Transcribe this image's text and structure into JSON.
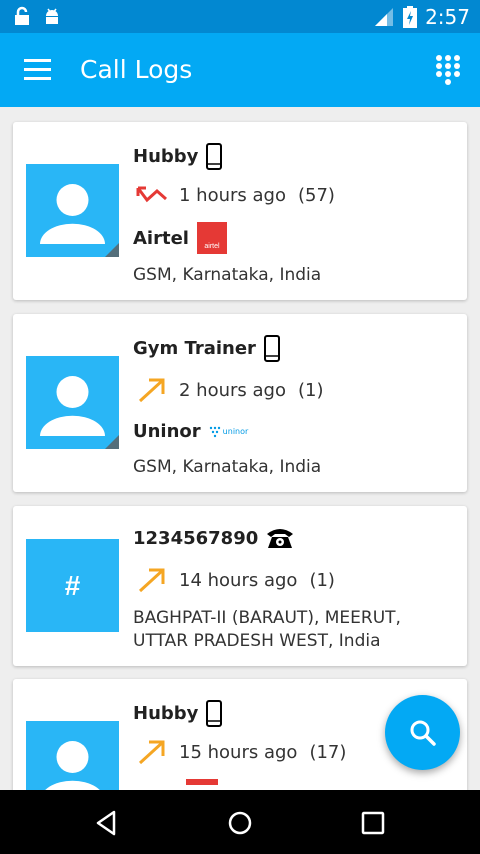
{
  "status_bar": {
    "time": "2:57"
  },
  "app_bar": {
    "title": "Call Logs"
  },
  "calls": [
    {
      "name": "Hubby",
      "time_ago": "1 hours ago",
      "count": "(57)",
      "direction": "missed",
      "operator": "Airtel",
      "operator_logo_text": "airtel",
      "location": "GSM, Karnataka, India",
      "device": "mobile"
    },
    {
      "name": "Gym Trainer",
      "time_ago": "2 hours ago",
      "count": "(1)",
      "direction": "outgoing",
      "operator": "Uninor",
      "operator_logo_text": "uninor",
      "location": "GSM, Karnataka, India",
      "device": "mobile"
    },
    {
      "name": "1234567890",
      "time_ago": "14 hours ago",
      "count": "(1)",
      "direction": "outgoing",
      "avatar_text": "#",
      "location": "BAGHPAT-II (BARAUT), MEERUT, UTTAR PRADESH WEST, India",
      "device": "landline"
    },
    {
      "name": "Hubby",
      "time_ago": "15 hours ago",
      "count": "(17)",
      "direction": "outgoing",
      "device": "mobile"
    }
  ],
  "colors": {
    "status_bar": "#0288d1",
    "app_bar": "#03a9f4",
    "avatar": "#29b6f6",
    "missed": "#e53935",
    "outgoing": "#f5a623"
  }
}
